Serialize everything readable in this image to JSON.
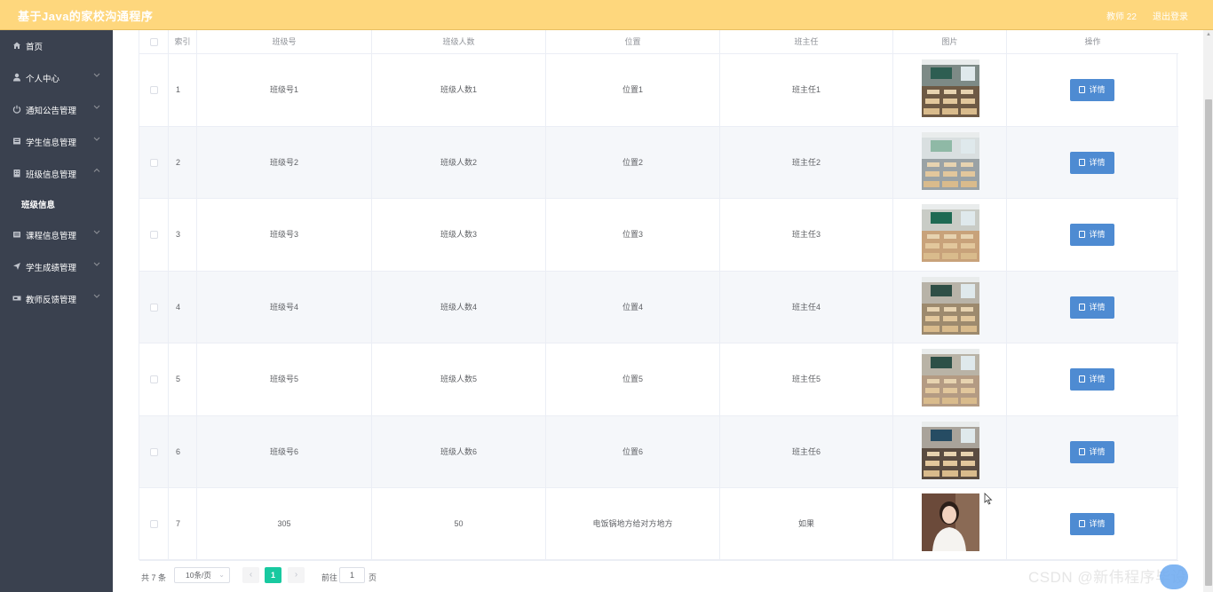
{
  "header": {
    "title": "基于Java的家校沟通程序",
    "user_role": "教师 22",
    "logout_label": "退出登录"
  },
  "sidebar": {
    "items": [
      {
        "label": "首页",
        "icon": "home-icon"
      },
      {
        "label": "个人中心",
        "icon": "user-icon"
      },
      {
        "label": "通知公告管理",
        "icon": "power-icon"
      },
      {
        "label": "学生信息管理",
        "icon": "book-icon"
      },
      {
        "label": "班级信息管理",
        "icon": "building-icon"
      },
      {
        "label": "课程信息管理",
        "icon": "course-icon"
      },
      {
        "label": "学生成绩管理",
        "icon": "send-icon"
      },
      {
        "label": "教师反馈管理",
        "icon": "ticket-icon"
      }
    ],
    "submenu": {
      "label": "班级信息"
    }
  },
  "table": {
    "columns": [
      "索引",
      "班级号",
      "班级人数",
      "位置",
      "班主任",
      "图片",
      "操作"
    ],
    "rows": [
      {
        "index": "1",
        "class_no": "班级号1",
        "count": "班级人数1",
        "location": "位置1",
        "teacher": "班主任1",
        "photo": "classroom-photo"
      },
      {
        "index": "2",
        "class_no": "班级号2",
        "count": "班级人数2",
        "location": "位置2",
        "teacher": "班主任2",
        "photo": "classroom-photo"
      },
      {
        "index": "3",
        "class_no": "班级号3",
        "count": "班级人数3",
        "location": "位置3",
        "teacher": "班主任3",
        "photo": "classroom-photo"
      },
      {
        "index": "4",
        "class_no": "班级号4",
        "count": "班级人数4",
        "location": "位置4",
        "teacher": "班主任4",
        "photo": "classroom-photo"
      },
      {
        "index": "5",
        "class_no": "班级号5",
        "count": "班级人数5",
        "location": "位置5",
        "teacher": "班主任5",
        "photo": "classroom-photo"
      },
      {
        "index": "6",
        "class_no": "班级号6",
        "count": "班级人数6",
        "location": "位置6",
        "teacher": "班主任6",
        "photo": "classroom-photo"
      },
      {
        "index": "7",
        "class_no": "305",
        "count": "50",
        "location": "电饭锅地方给对方地方",
        "teacher": "如果",
        "photo": "portrait-photo"
      }
    ],
    "detail_label": "详情"
  },
  "pagination": {
    "total": "共 7 条",
    "page_size": "10条/页",
    "prev": "‹",
    "next": "›",
    "current_page": "1",
    "goto_label": "前往",
    "goto_value": "1",
    "goto_unit": "页"
  },
  "watermark": "CSDN @新伟程序毕设",
  "colors": {
    "header": "#fed77d",
    "sidebar": "#3a414f",
    "detail_button": "#4e8bd2",
    "active_page": "#18c9a0"
  }
}
